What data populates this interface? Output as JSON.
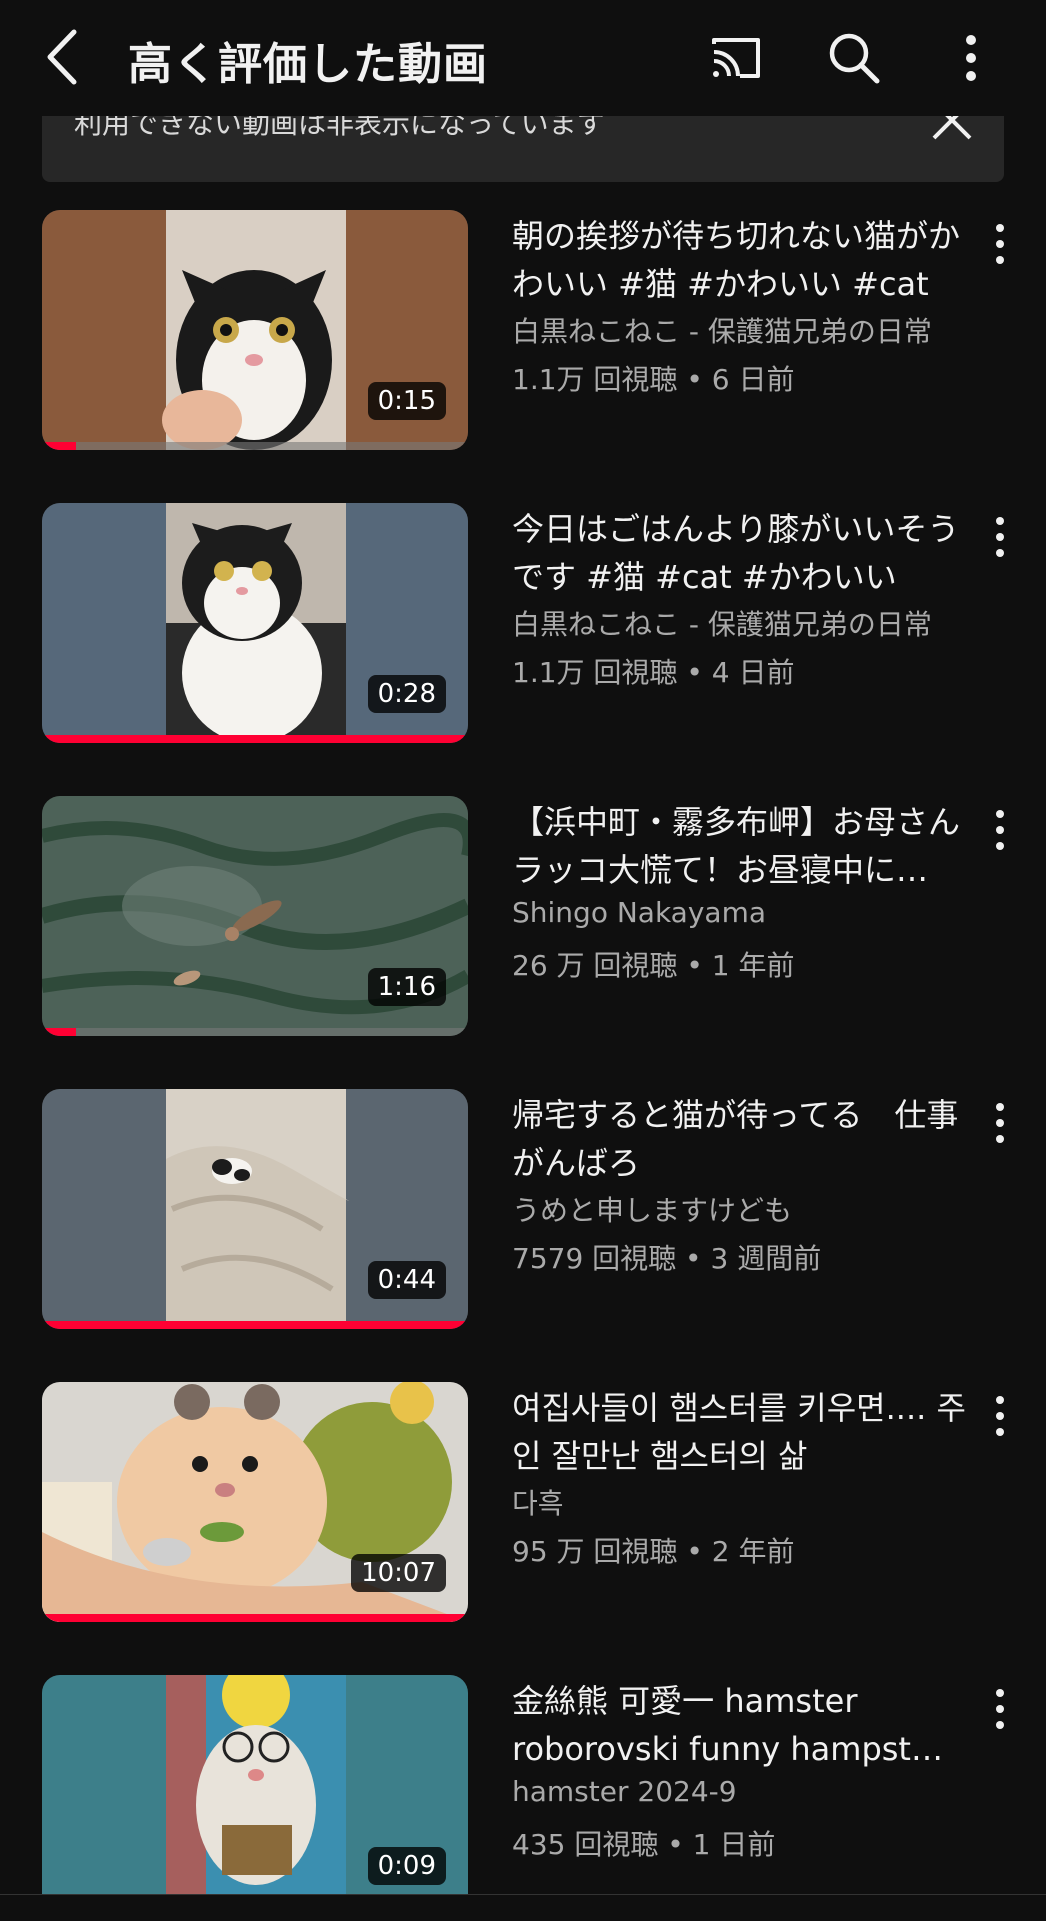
{
  "header": {
    "title": "高く評価した動画",
    "icons": [
      "back-arrow-icon",
      "cast-icon",
      "search-icon",
      "more-vertical-icon"
    ]
  },
  "notice": {
    "text": "利用できない動画は非表示になっています"
  },
  "videos": [
    {
      "title": "朝の挨拶が待ち切れない猫がかわいい #猫 #かわいい #cat",
      "channel": "白黒ねこねこ - 保護猫兄弟の日常",
      "meta": "1.1万 回視聴 • 6 日前",
      "duration": "0:15",
      "watched_fraction": 0.08
    },
    {
      "title": "今日はごはんより膝がいいそうです #猫 #cat #かわいい",
      "channel": "白黒ねこねこ - 保護猫兄弟の日常",
      "meta": "1.1万 回視聴 • 4 日前",
      "duration": "0:28",
      "watched_fraction": 1.0
    },
    {
      "title": "【浜中町・霧多布岬】お母さんラッコ大慌て！お昼寝中に…",
      "channel": "Shingo Nakayama",
      "meta": "26 万 回視聴 • 1 年前",
      "duration": "1:16",
      "watched_fraction": 0.08
    },
    {
      "title": "帰宅すると猫が待ってる　仕事がんばろ",
      "channel": "うめと申しますけども",
      "meta": "7579 回視聴 • 3 週間前",
      "duration": "0:44",
      "watched_fraction": 1.0
    },
    {
      "title": "여집사들이 햄스터를 키우면.... 주인 잘만난 햄스터의 삶",
      "channel": "다흑",
      "meta": "95 万 回視聴 • 2 年前",
      "duration": "10:07",
      "watched_fraction": 1.0
    },
    {
      "title": "金絲熊 可愛一 hamster roborovski funny hampst…",
      "channel": "hamster 2024-9",
      "meta": "435 回視聴 • 1 日前",
      "duration": "0:09",
      "watched_fraction": 0.0
    }
  ],
  "colors": {
    "background": "#0f0f0f",
    "progress": "#ff0033",
    "secondary_text": "#aaaaaa"
  }
}
